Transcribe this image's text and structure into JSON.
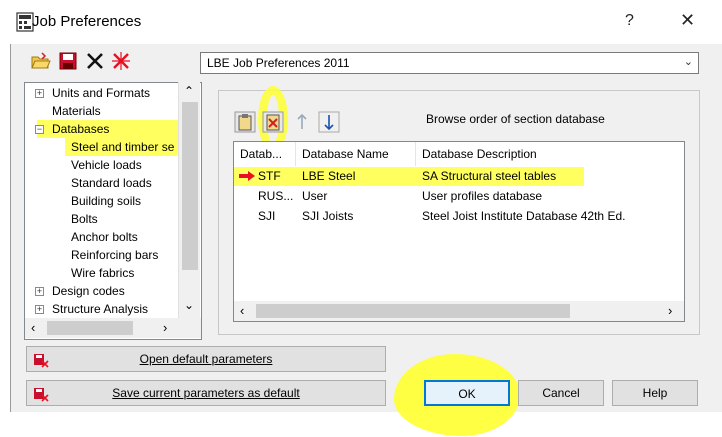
{
  "window": {
    "title": "Job Preferences",
    "help_label": "?",
    "close_label": "✕"
  },
  "toolbar": {
    "icons": [
      "open-folder-icon",
      "save-icon",
      "delete-icon",
      "clear-icon"
    ]
  },
  "preferences_combo": {
    "value": "LBE Job Preferences 2011"
  },
  "tree": {
    "items": [
      {
        "label": "Units and Formats",
        "expander": "+"
      },
      {
        "label": "Materials"
      },
      {
        "label": "Databases",
        "expander": "−"
      },
      {
        "label": "Steel and timber se"
      },
      {
        "label": "Vehicle loads"
      },
      {
        "label": "Standard loads"
      },
      {
        "label": "Building soils"
      },
      {
        "label": "Bolts"
      },
      {
        "label": "Anchor bolts"
      },
      {
        "label": "Reinforcing bars"
      },
      {
        "label": "Wire fabrics"
      },
      {
        "label": "Design codes",
        "expander": "+"
      },
      {
        "label": "Structure Analysis",
        "expander": "+"
      }
    ]
  },
  "database_panel": {
    "caption": "Browse order of section database",
    "columns": [
      "Datab...",
      "Database Name",
      "Database Description"
    ],
    "rows": [
      {
        "code": "STF",
        "name": "LBE Steel",
        "description": "SA Structural steel tables"
      },
      {
        "code": "RUS...",
        "name": "User",
        "description": "User profiles database"
      },
      {
        "code": "SJI",
        "name": "SJI Joists",
        "description": "Steel Joist Institute Database 42th Ed."
      }
    ]
  },
  "buttons": {
    "open_default": "Open default parameters",
    "save_default": "Save current parameters as default",
    "ok": "OK",
    "cancel": "Cancel",
    "help": "Help"
  },
  "colors": {
    "highlight": "#ffff33",
    "accent": "#0078d7",
    "arrow": "#e81123"
  }
}
